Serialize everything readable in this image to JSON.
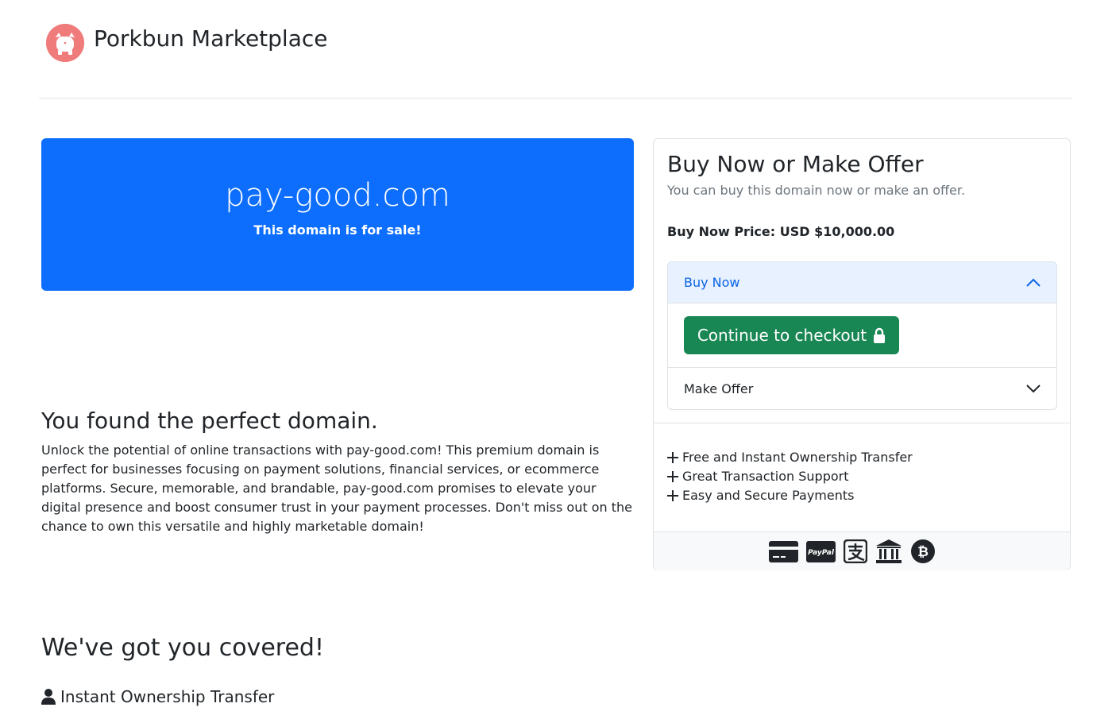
{
  "header": {
    "brand": "Porkbun Marketplace",
    "logo_icon": "pig-logo-icon"
  },
  "hero": {
    "domain": "pay-good.com",
    "subtitle": "This domain is for sale!",
    "background": "#0d6efd"
  },
  "about": {
    "title": "You found the perfect domain.",
    "description": "Unlock the potential of online transactions with pay-good.com! This premium domain is perfect for businesses focusing on payment solutions, financial services, or ecommerce platforms. Secure, memorable, and brandable, pay-good.com promises to elevate your digital presence and boost consumer trust in your payment processes. Don't miss out on the chance to own this versatile and highly marketable domain!"
  },
  "covered": {
    "title": "We've got you covered!",
    "item": "Instant Ownership Transfer",
    "item_icon": "user-icon"
  },
  "offer_card": {
    "title": "Buy Now or Make Offer",
    "subtitle": "You can buy this domain now or make an offer.",
    "price": "Buy Now Price: USD $10,000.00",
    "accordion": {
      "buy_now_label": "Buy Now",
      "checkout_label": "Continue to checkout",
      "make_offer_label": "Make Offer"
    },
    "features": [
      "Free and Instant Ownership Transfer",
      "Great Transaction Support",
      "Easy and Secure Payments"
    ],
    "payment_icons": [
      "credit-card-icon",
      "paypal-icon",
      "alipay-icon",
      "bank-icon",
      "bitcoin-icon"
    ],
    "paypal_text": "PayPal",
    "checkout_color": "#198754"
  }
}
